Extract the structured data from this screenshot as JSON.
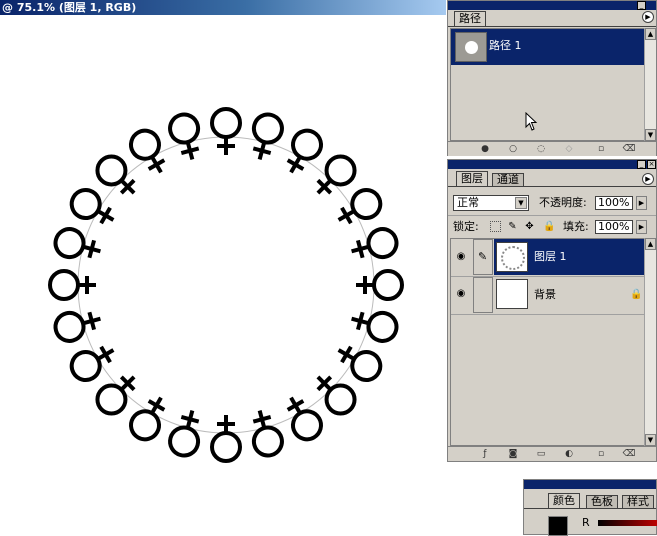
{
  "document": {
    "title": "@ 75.1% (图层 1, RGB)"
  },
  "paths_panel": {
    "tab": "路径",
    "menu_icon": "panel-menu-arrow-icon",
    "items": [
      {
        "name": "路径 1",
        "selected": true
      }
    ],
    "bottom_buttons": [
      "fill-path-icon",
      "stroke-path-icon",
      "load-selection-icon",
      "make-work-path-icon",
      "new-path-icon",
      "delete-path-icon"
    ]
  },
  "layers_panel": {
    "tabs": [
      {
        "label": "图层",
        "active": true
      },
      {
        "label": "通道",
        "active": false
      }
    ],
    "blend_mode": "正常",
    "opacity_label": "不透明度:",
    "opacity_value": "100%",
    "lock_label": "锁定:",
    "fill_label": "填充:",
    "fill_value": "100%",
    "layers": [
      {
        "name": "图层 1",
        "selected": true,
        "visible": true,
        "linked_brush": true
      },
      {
        "name": "背景",
        "selected": false,
        "visible": true,
        "locked": true
      }
    ]
  },
  "color_panel": {
    "tabs": [
      {
        "label": "颜色",
        "active": true
      },
      {
        "label": "色板",
        "active": false
      },
      {
        "label": "样式",
        "active": false
      }
    ],
    "channel_label": "R"
  },
  "colors": {
    "selection_blue": "#0a246a",
    "panel_gray": "#d4d0c8"
  }
}
